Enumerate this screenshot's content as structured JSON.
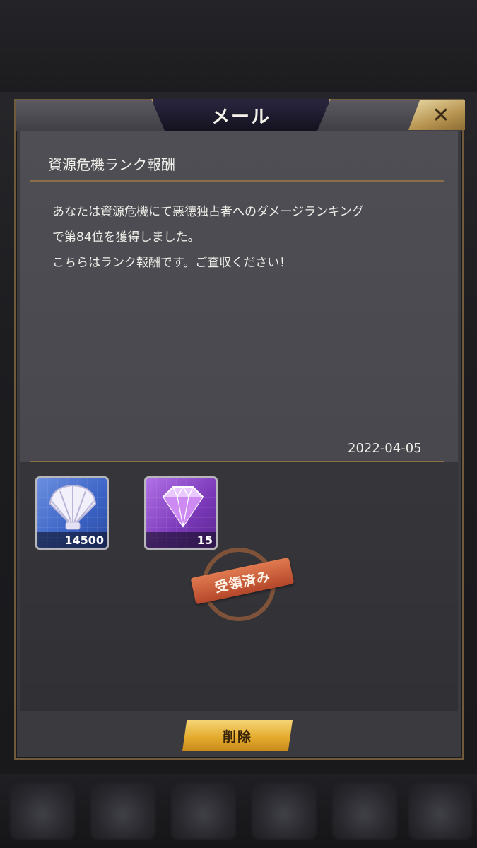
{
  "dialog": {
    "title": "メール",
    "close_label": "✕"
  },
  "mail": {
    "subject": "資源危機ランク報酬",
    "body_lines": [
      "あなたは資源危機にて悪徳独占者へのダメージランキング",
      "で第84位を獲得しました。",
      "こちらはランク報酬です。ご査収ください！"
    ],
    "date": "2022-04-05"
  },
  "rewards": [
    {
      "icon": "shell-icon",
      "count": "14500"
    },
    {
      "icon": "diamond-icon",
      "count": "15"
    }
  ],
  "stamp": {
    "label": "受領済み"
  },
  "footer": {
    "delete_label": "削除"
  },
  "colors": {
    "accent_gold": "#b9985e",
    "delete_button": "#e4ac2e",
    "stamp": "#c0532f"
  }
}
